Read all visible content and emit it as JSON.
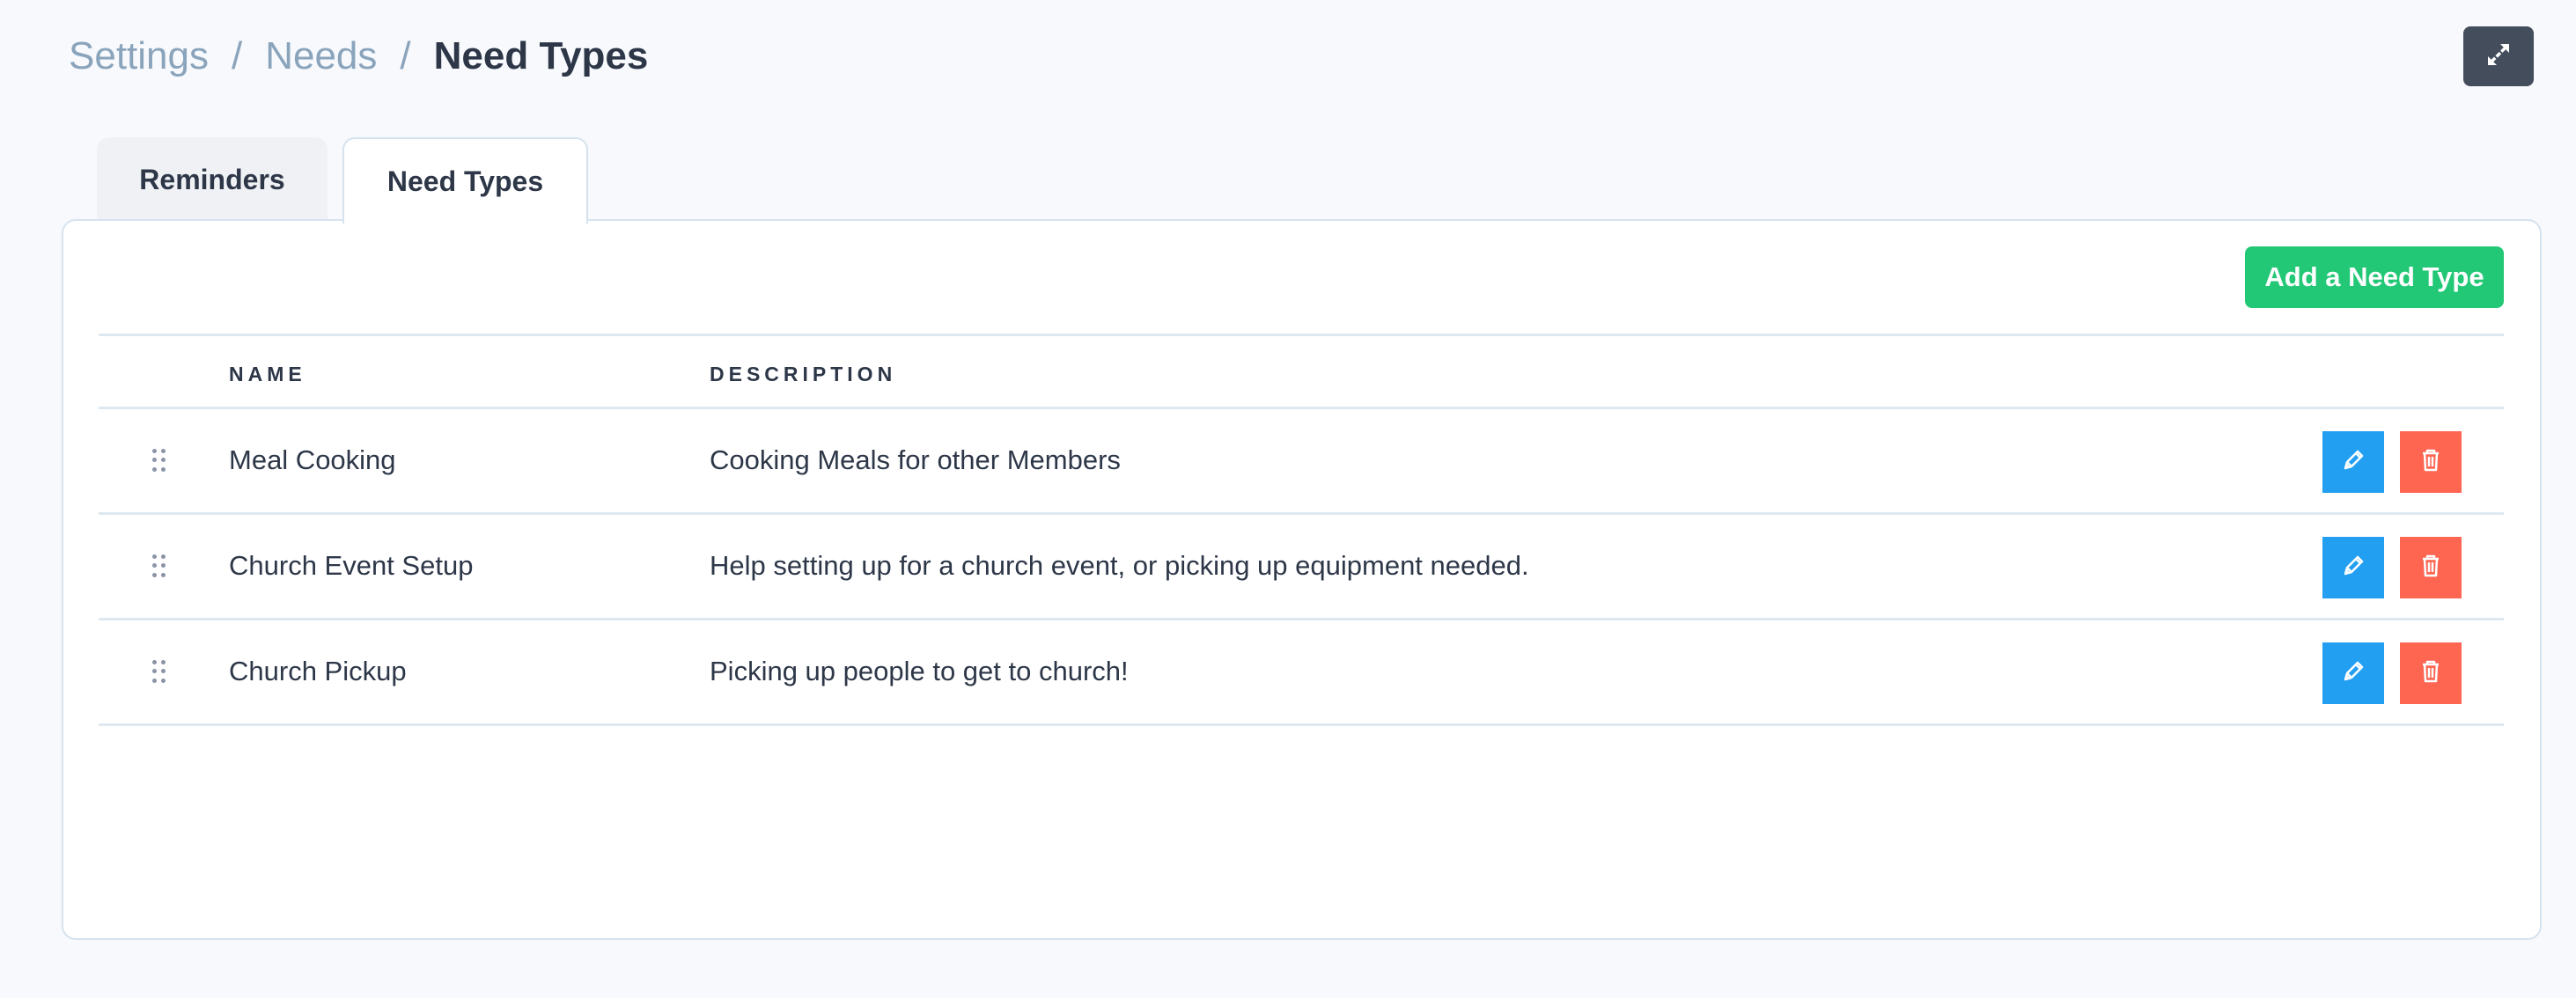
{
  "breadcrumb": {
    "items": [
      "Settings",
      "Needs"
    ],
    "separator": "/",
    "current": "Need Types"
  },
  "header": {
    "expand_icon": "expand-arrows-icon"
  },
  "tabs": [
    {
      "label": "Reminders",
      "active": false
    },
    {
      "label": "Need Types",
      "active": true
    }
  ],
  "toolbar": {
    "add_label": "Add a Need Type"
  },
  "table": {
    "columns": [
      "NAME",
      "DESCRIPTION"
    ],
    "rows": [
      {
        "name": "Meal Cooking",
        "description": "Cooking Meals for other Members"
      },
      {
        "name": "Church Event Setup",
        "description": "Help setting up for a church event, or picking up equipment needed."
      },
      {
        "name": "Church Pickup",
        "description": "Picking up people to get to church!"
      }
    ],
    "row_actions": {
      "edit_icon": "pencil-icon",
      "delete_icon": "trash-icon"
    }
  },
  "colors": {
    "accent_green": "#22c876",
    "edit_blue": "#239ff2",
    "delete_red": "#fe6652",
    "text_dark": "#2d3748",
    "breadcrumb_muted": "#8aa4bc"
  }
}
